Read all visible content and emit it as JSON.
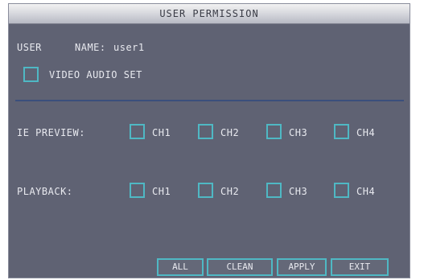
{
  "dialog": {
    "title": "USER PERMISSION"
  },
  "user": {
    "label": "USER",
    "name_label": "NAME:",
    "name_value": "user1"
  },
  "video_audio_set": {
    "label": "VIDEO AUDIO SET",
    "checked": false
  },
  "ie_preview": {
    "label": "IE PREVIEW:",
    "channels": [
      {
        "label": "CH1",
        "checked": false
      },
      {
        "label": "CH2",
        "checked": false
      },
      {
        "label": "CH3",
        "checked": false
      },
      {
        "label": "CH4",
        "checked": false
      }
    ]
  },
  "playback": {
    "label": "PLAYBACK:",
    "channels": [
      {
        "label": "CH1",
        "checked": false
      },
      {
        "label": "CH2",
        "checked": false
      },
      {
        "label": "CH3",
        "checked": false
      },
      {
        "label": "CH4",
        "checked": false
      }
    ]
  },
  "buttons": {
    "all": "ALL",
    "clean": "CLEAN",
    "apply": "APPLY",
    "exit": "EXIT"
  },
  "colors": {
    "panel": "#5f6273",
    "checkbox_border": "#4fb8c4",
    "divider": "#3b4f7c",
    "text": "#e8e9ef"
  }
}
